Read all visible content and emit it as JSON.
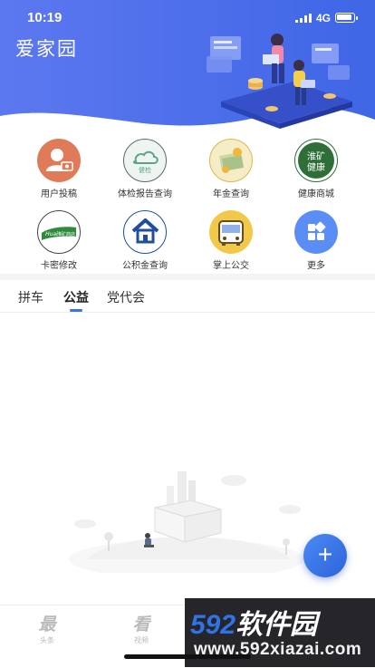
{
  "status": {
    "time": "10:19",
    "network": "4G"
  },
  "app": {
    "title": "爱家园"
  },
  "grid": [
    {
      "label": "用户投稿",
      "icon": "user-camera-icon",
      "color": "#e07b5a"
    },
    {
      "label": "体检报告查询",
      "icon": "cloud-health-check-icon",
      "color": "#e9f2ee"
    },
    {
      "label": "年金查询",
      "icon": "pension-money-icon",
      "color": "#f5e9b8"
    },
    {
      "label": "健康商城",
      "icon": "huaikuang-health-mall-icon",
      "color": "#2d6f37",
      "icon_text": "淮矿健康"
    },
    {
      "label": "卡密修改",
      "icon": "card-password-icon",
      "color": "#ffffff",
      "icon_text": "Huaikuang 淮矿商店"
    },
    {
      "label": "公积金查询",
      "icon": "housing-fund-house-icon",
      "color": "#ffffff"
    },
    {
      "label": "掌上公交",
      "icon": "bus-icon",
      "color": "#f1c94a"
    },
    {
      "label": "更多",
      "icon": "more-apps-icon",
      "color": "#5b8ef5"
    }
  ],
  "tabs": [
    {
      "label": "拼车",
      "active": false
    },
    {
      "label": "公益",
      "active": true
    },
    {
      "label": "党代会",
      "active": false
    }
  ],
  "fab": {
    "symbol": "+"
  },
  "bottom_nav": [
    {
      "glyph": "最",
      "label": "头条"
    },
    {
      "glyph": "看",
      "label": "视频"
    }
  ],
  "watermark": {
    "brand_num": "592",
    "brand_cn": "软件园",
    "url": "www.592xiazai.com"
  },
  "colors": {
    "header_start": "#5b7cf0",
    "header_end": "#3c63e3",
    "accent": "#3b73e6"
  }
}
